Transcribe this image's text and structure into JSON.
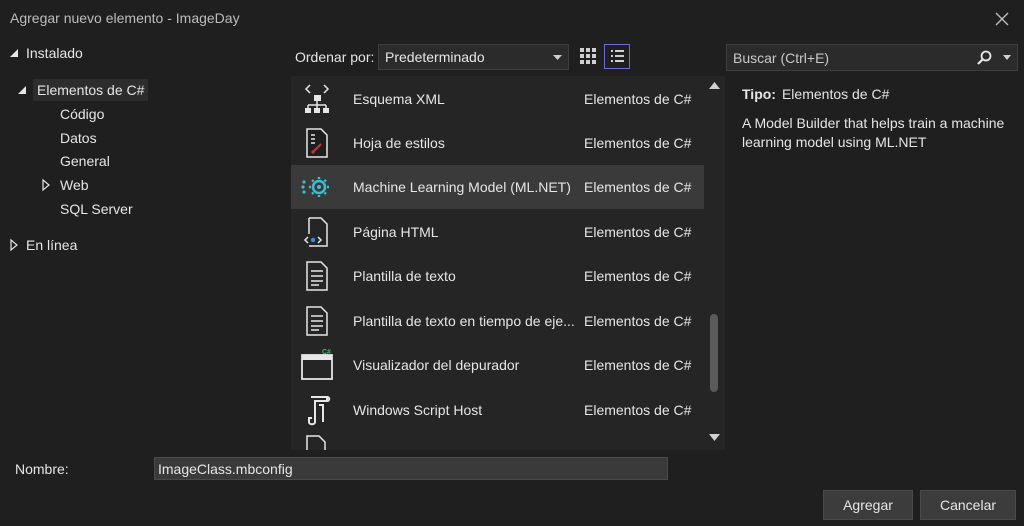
{
  "window": {
    "title": "Agregar nuevo elemento - ImageDay",
    "close_icon": "close-icon"
  },
  "tree": {
    "installed": "Instalado",
    "csharp": "Elementos de C#",
    "children": [
      "Código",
      "Datos",
      "General",
      "Web",
      "SQL Server"
    ],
    "online": "En línea"
  },
  "toolbar": {
    "sort_label": "Ordenar por:",
    "sort_value": "Predeterminado",
    "grid_icon": "grid-view-icon",
    "list_icon": "list-view-icon"
  },
  "search": {
    "placeholder": "Buscar (Ctrl+E)",
    "icon": "search-icon"
  },
  "items": [
    {
      "name": "Esquema XML",
      "category": "Elementos de C#",
      "icon": "xml-schema-icon"
    },
    {
      "name": "Hoja de estilos",
      "category": "Elementos de C#",
      "icon": "stylesheet-icon"
    },
    {
      "name": "Machine Learning Model (ML.NET)",
      "category": "Elementos de C#",
      "icon": "ml-model-icon",
      "selected": true
    },
    {
      "name": "Página HTML",
      "category": "Elementos de C#",
      "icon": "html-page-icon"
    },
    {
      "name": "Plantilla de texto",
      "category": "Elementos de C#",
      "icon": "text-template-icon"
    },
    {
      "name": "Plantilla de texto en tiempo de eje...",
      "category": "Elementos de C#",
      "icon": "runtime-text-template-icon"
    },
    {
      "name": "Visualizador del depurador",
      "category": "Elementos de C#",
      "icon": "debugger-visualizer-icon"
    },
    {
      "name": "Windows Script Host",
      "category": "Elementos de C#",
      "icon": "windows-script-host-icon"
    }
  ],
  "details": {
    "tipo_label": "Tipo:",
    "tipo_value": "Elementos de C#",
    "description": "A Model Builder that helps train a machine learning model using ML.NET"
  },
  "form": {
    "name_label": "Nombre:",
    "name_value": "ImageClass.mbconfig",
    "add_button": "Agregar",
    "cancel_button": "Cancelar"
  }
}
